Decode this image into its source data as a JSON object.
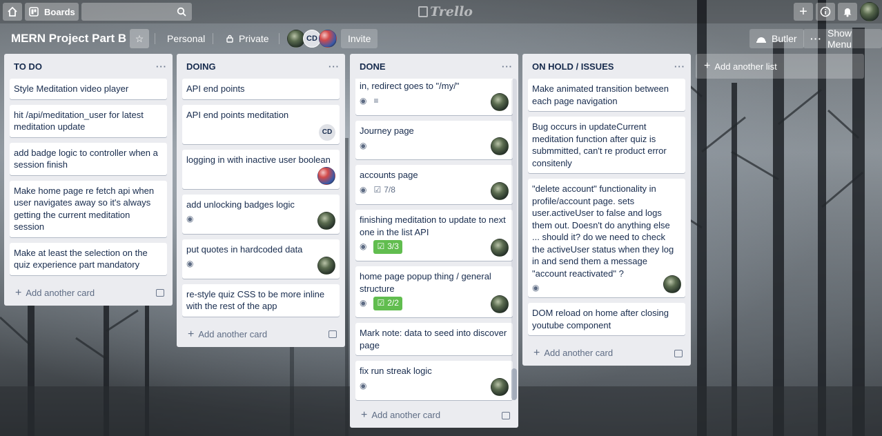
{
  "topbar": {
    "boards_label": "Boards",
    "logo_text": "Trello"
  },
  "board": {
    "title": "MERN Project Part B",
    "team_label": "Personal",
    "visibility_label": "Private",
    "member_initials": "CD",
    "invite_label": "Invite",
    "butler_label": "Butler",
    "show_menu_label": "Show Menu"
  },
  "add_card_label": "Add another card",
  "add_list_label": "Add another list",
  "lists": [
    {
      "title": "TO DO",
      "cards": [
        {
          "title": "Style Meditation video player"
        },
        {
          "title": "hit /api/meditation_user for latest meditation update"
        },
        {
          "title": "add badge logic to controller when a session finish"
        },
        {
          "title": "Make home page re fetch api when user navigates away so it's always getting the current meditation session"
        },
        {
          "title": "Make at least the selection on the quiz experience part mandatory"
        }
      ]
    },
    {
      "title": "DOING",
      "cards": [
        {
          "title": "API end points"
        },
        {
          "title": "API end points meditation",
          "member": "CD"
        },
        {
          "title": "logging in with inactive user boolean"
        },
        {
          "title": "add unlocking badges logic"
        },
        {
          "title": "put quotes in hardcoded data"
        },
        {
          "title": "re-style quiz CSS to be more inline with the rest of the app"
        }
      ]
    },
    {
      "title": "DONE",
      "cards": [
        {
          "title": "in, redirect goes to \"/my/\""
        },
        {
          "title": "Journey page"
        },
        {
          "title": "accounts page",
          "checklist": "7/8"
        },
        {
          "title": "finishing meditation to update to next one in the list API",
          "checklist": "3/3"
        },
        {
          "title": "home page popup thing / general structure",
          "checklist": "2/2"
        },
        {
          "title": "Mark note: data to seed into discover page"
        },
        {
          "title": "fix run streak logic"
        }
      ]
    },
    {
      "title": "ON HOLD / ISSUES",
      "cards": [
        {
          "title": "Make animated transition between each page navigation"
        },
        {
          "title": "Bug occurs in updateCurrent meditation function after quiz is submmitted, can't re product error consitenly"
        },
        {
          "title": "\"delete account\" functionality in profile/account page. sets user.activeUser to false and logs them out. Doesn't do anything else ... should it? do we need to check the activeUser status when they log in and send them a message \"account reactivated\" ?"
        },
        {
          "title": "DOM reload on home after closing youtube component"
        }
      ]
    }
  ]
}
